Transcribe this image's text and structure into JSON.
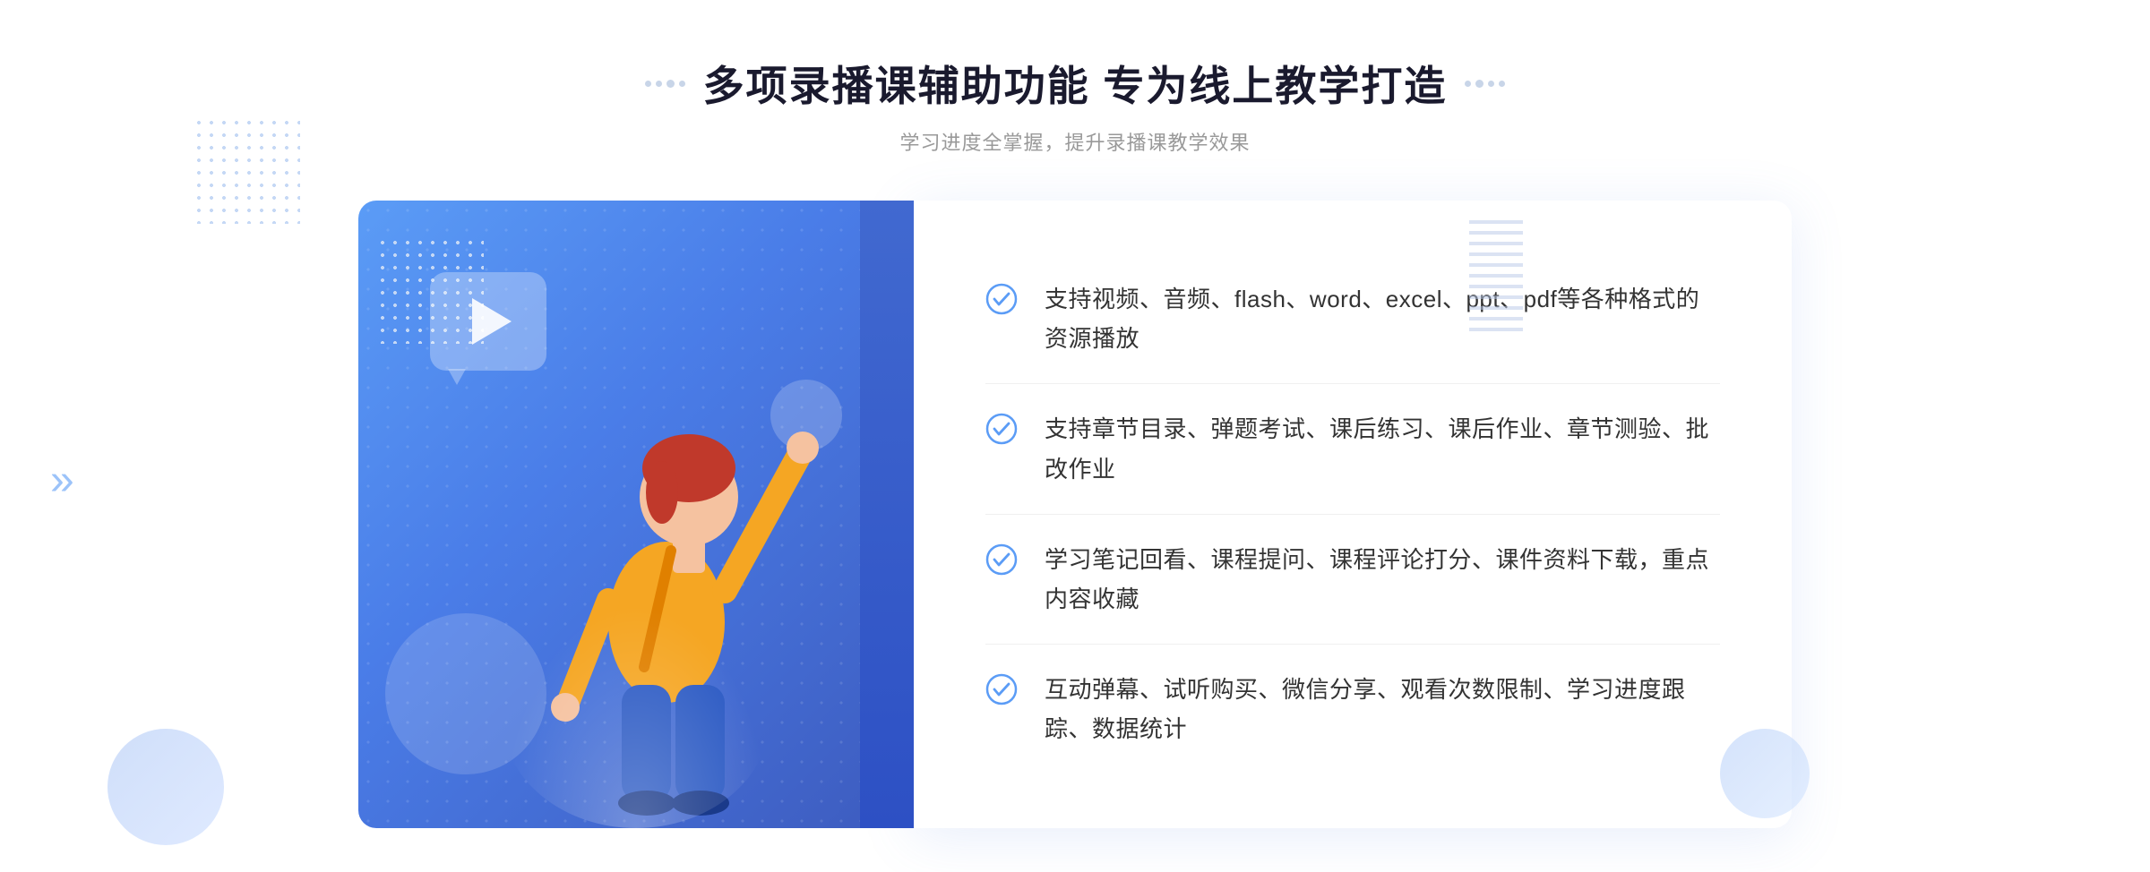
{
  "header": {
    "title": "多项录播课辅助功能 专为线上教学打造",
    "subtitle": "学习进度全掌握，提升录播课教学效果"
  },
  "features": [
    {
      "id": "feature-1",
      "text": "支持视频、音频、flash、word、excel、ppt、pdf等各种格式的资源播放"
    },
    {
      "id": "feature-2",
      "text": "支持章节目录、弹题考试、课后练习、课后作业、章节测验、批改作业"
    },
    {
      "id": "feature-3",
      "text": "学习笔记回看、课程提问、课程评论打分、课件资料下载，重点内容收藏"
    },
    {
      "id": "feature-4",
      "text": "互动弹幕、试听购买、微信分享、观看次数限制、学习进度跟踪、数据统计"
    }
  ],
  "decorators": {
    "title_dots_left": "⠿",
    "title_dots_right": "⠿",
    "chevron_symbol": "»"
  }
}
